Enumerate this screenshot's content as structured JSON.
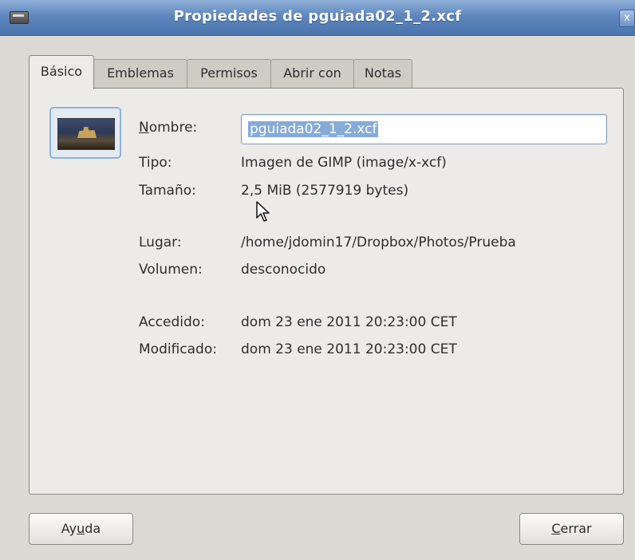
{
  "window": {
    "title": "Propiedades de pguiada02_1_2.xcf",
    "close_glyph": "x"
  },
  "tabs": [
    {
      "label": "Básico",
      "active": true
    },
    {
      "label": "Emblemas",
      "active": false
    },
    {
      "label": "Permisos",
      "active": false
    },
    {
      "label": "Abrir con",
      "active": false
    },
    {
      "label": "Notas",
      "active": false
    }
  ],
  "basic": {
    "thumbnail": "image-thumbnail",
    "name_label_mnemonic": "N",
    "name_label_rest": "ombre:",
    "name_value": "pguiada02_1_2.xcf",
    "type_label": "Tipo:",
    "type_value": "Imagen de GIMP (image/x-xcf)",
    "size_label": "Tamaño:",
    "size_value": "2,5 MiB (2577919 bytes)",
    "location_label": "Lugar:",
    "location_value": "/home/jdomin17/Dropbox/Photos/Prueba",
    "volume_label": "Volumen:",
    "volume_value": "desconocido",
    "accessed_label": "Accedido:",
    "accessed_value": "dom 23 ene 2011 20:23:00 CET",
    "modified_label": "Modificado:",
    "modified_value": "dom 23 ene 2011 20:23:00 CET"
  },
  "buttons": {
    "help_prefix": "Ay",
    "help_mnemonic": "u",
    "help_suffix": "da",
    "close_mnemonic": "C",
    "close_suffix": "errar"
  },
  "colors": {
    "titlebar": "#5f86bd",
    "selection": "#86abd9",
    "dialog_bg": "#dcdad5"
  }
}
